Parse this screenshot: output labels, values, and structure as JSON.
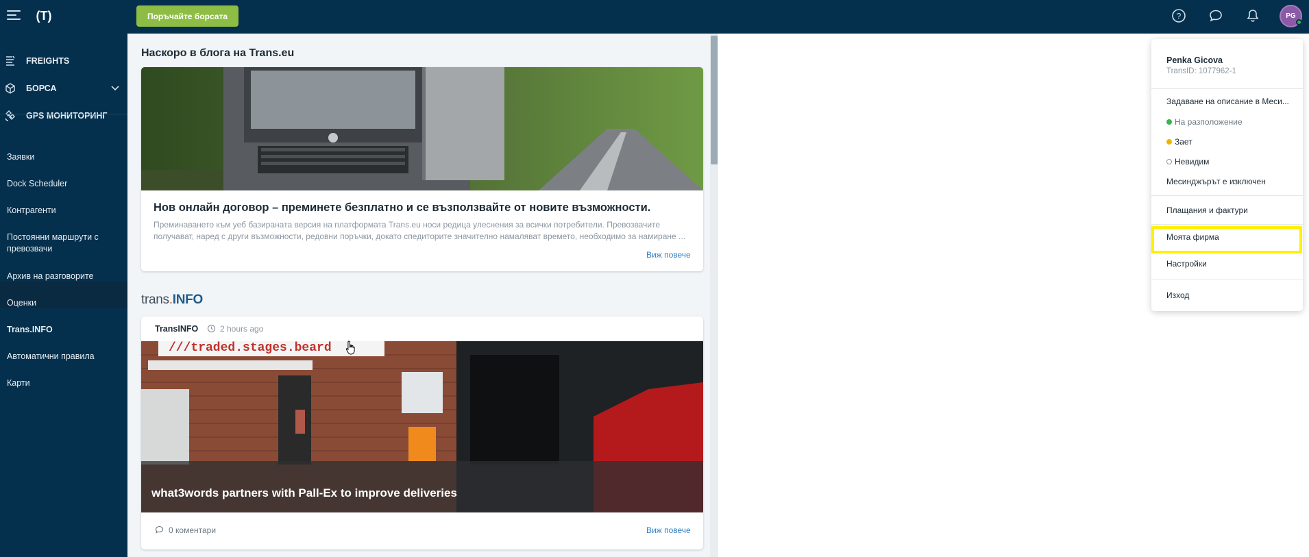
{
  "header": {
    "logo_text": "(T)",
    "order_button_label": "Поръчайте борсата",
    "icons": [
      "menu-icon",
      "help-icon",
      "chat-icon",
      "bell-icon"
    ],
    "avatar_initials": "PG",
    "colors": {
      "topbar": "#05304d",
      "accent_green": "#8ebd45",
      "link_blue": "#2f80c4",
      "highlight": "#fff000"
    }
  },
  "sidebar": {
    "main_items": [
      {
        "label": "FREIGHTS",
        "icon": "truck-icon"
      },
      {
        "label": "БОРСА",
        "icon": "cube-icon",
        "expandable": true
      },
      {
        "label": "GPS МОНИТОРИНГ",
        "icon": "satellite-icon"
      }
    ],
    "items": [
      {
        "label": "Заявки"
      },
      {
        "label": "Dock Scheduler"
      },
      {
        "label": "Контрагенти"
      },
      {
        "label": "Постоянни маршрути с превозвачи"
      },
      {
        "label": "Архив на разговорите"
      },
      {
        "label": "Оценки"
      },
      {
        "label": "Trans.INFO",
        "active": true
      },
      {
        "label": "Автоматични правила"
      },
      {
        "label": "Карти"
      }
    ]
  },
  "main": {
    "blog_section_title": "Наскоро в блога на Trans.eu",
    "blog_card": {
      "headline": "Нов онлайн договор – преминете безплатно и се възползвайте от новите възможности.",
      "excerpt": "Преминаването към уеб базираната версия на платформата Trans.eu носи редица улеснения за всички потребители. Превозвачите получават, наред с други възможности, редовни поръчки, докато спедиторите значително намаляват времето, необходимо за намиране ...",
      "more_label": "Виж повече"
    },
    "transinfo_logo": {
      "prefix": "trans",
      "dot": ".",
      "suffix": "INFO"
    },
    "news_card": {
      "source": "TransINFO",
      "time": "2 hours ago",
      "caption": "what3words partners with Pall-Ex to improve deliveries",
      "image_sign_text": "///traded.stages.beard",
      "comments": "0 коментари",
      "more_label": "Виж повече"
    }
  },
  "user_menu": {
    "name": "Penka Gicova",
    "trans_id": "TransID: 1077962-1",
    "set_description": "Задаване на описание в Меси...",
    "statuses": [
      {
        "label": "На разположение",
        "color": "#39b54a",
        "muted": true
      },
      {
        "label": "Зает",
        "color": "#f0b400"
      },
      {
        "label": "Невидим",
        "color": "hollow"
      }
    ],
    "messenger_off": "Месинджърът е изключен",
    "payments": "Плащания и фактури",
    "my_company": "Моята фирма",
    "settings": "Настройки",
    "logout": "Изход"
  }
}
